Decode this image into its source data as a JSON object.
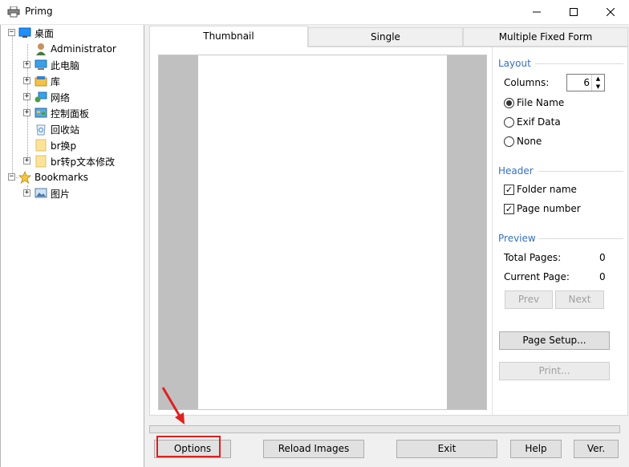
{
  "window": {
    "title": "Primg"
  },
  "tree": {
    "items": [
      {
        "label": "桌面",
        "icon": "desktop-icon"
      },
      {
        "label": "Administrator",
        "icon": "user-icon"
      },
      {
        "label": "此电脑",
        "icon": "computer-icon"
      },
      {
        "label": "库",
        "icon": "library-icon"
      },
      {
        "label": "网络",
        "icon": "network-icon"
      },
      {
        "label": "控制面板",
        "icon": "control-panel-icon"
      },
      {
        "label": "回收站",
        "icon": "recycle-bin-icon"
      },
      {
        "label": "br换p",
        "icon": "folder-icon"
      },
      {
        "label": "br转p文本修改",
        "icon": "folder-icon"
      },
      {
        "label": "Bookmarks",
        "icon": "star-icon"
      },
      {
        "label": "图片",
        "icon": "pictures-icon"
      }
    ]
  },
  "tabs": [
    {
      "label": "Thumbnail",
      "active": true
    },
    {
      "label": "Single",
      "active": false
    },
    {
      "label": "Multiple Fixed Form",
      "active": false
    }
  ],
  "layout": {
    "title": "Layout",
    "columns_label": "Columns:",
    "columns_value": "6",
    "options": [
      "File Name",
      "Exif Data",
      "None"
    ],
    "selected": "File Name"
  },
  "header": {
    "title": "Header",
    "folder_name": "Folder name",
    "page_number": "Page number"
  },
  "preview": {
    "title": "Preview",
    "total_pages_label": "Total Pages:",
    "total_pages_value": "0",
    "current_page_label": "Current Page:",
    "current_page_value": "0",
    "prev": "Prev",
    "next": "Next"
  },
  "buttons": {
    "page_setup": "Page Setup...",
    "print": "Print...",
    "options": "Options",
    "reload": "Reload Images",
    "exit": "Exit",
    "help": "Help",
    "version": "Ver."
  },
  "colors": {
    "accent": "#3670c4",
    "annotation": "#e02020"
  }
}
